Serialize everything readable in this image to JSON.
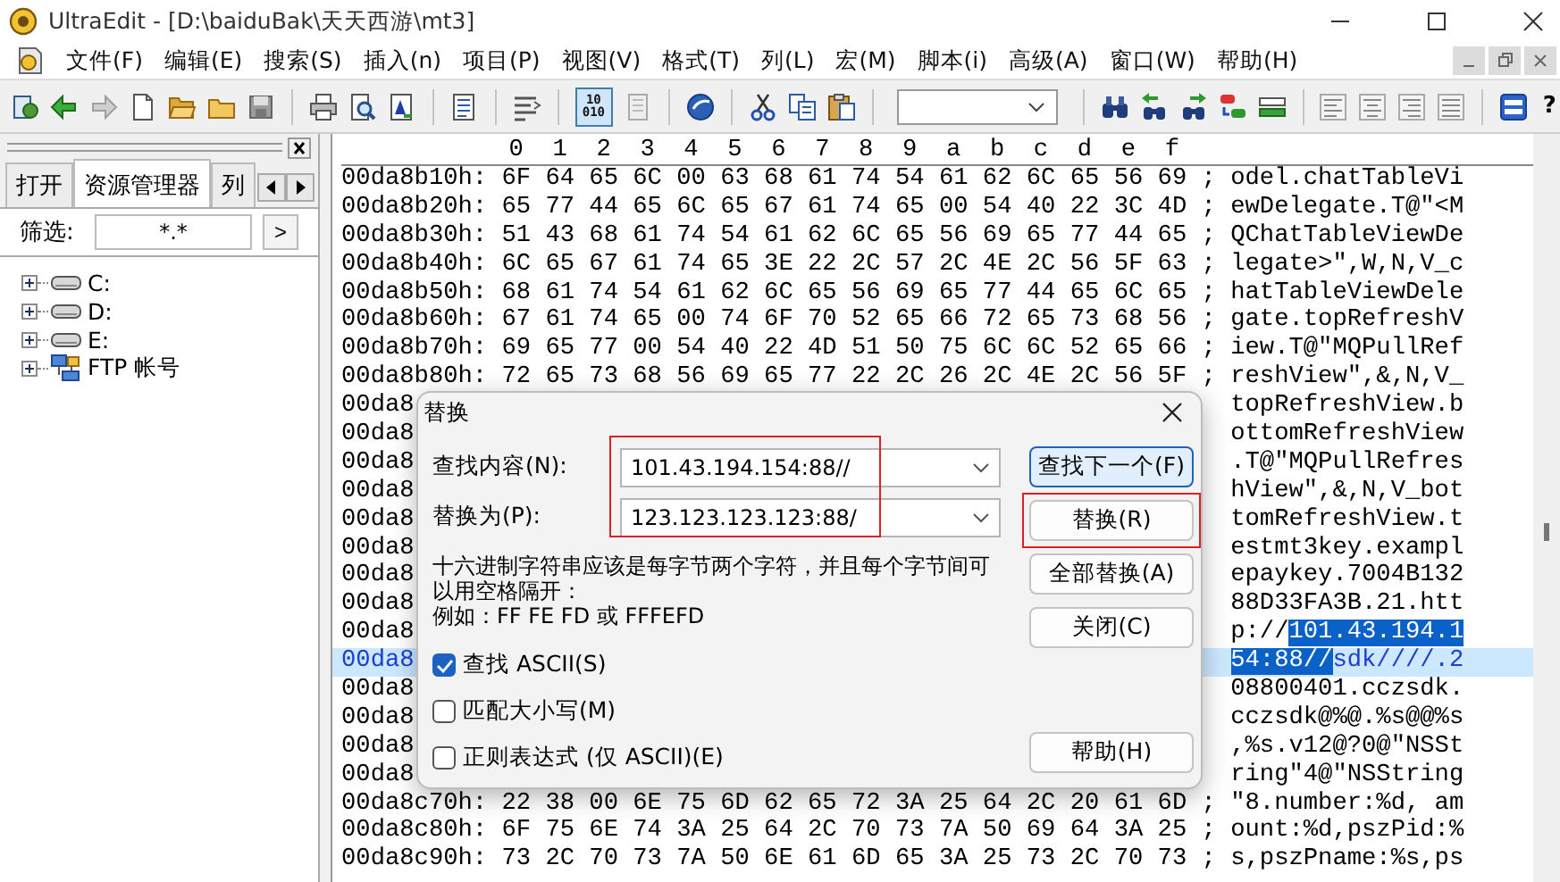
{
  "window": {
    "title": "UltraEdit - [D:\\baiduBak\\天天西游\\mt3]"
  },
  "menu": [
    {
      "label": "文件(F)"
    },
    {
      "label": "编辑(E)"
    },
    {
      "label": "搜索(S)"
    },
    {
      "label": "插入(n)"
    },
    {
      "label": "项目(P)"
    },
    {
      "label": "视图(V)"
    },
    {
      "label": "格式(T)"
    },
    {
      "label": "列(L)"
    },
    {
      "label": "宏(M)"
    },
    {
      "label": "脚本(i)"
    },
    {
      "label": "高级(A)"
    },
    {
      "label": "窗口(W)"
    },
    {
      "label": "帮助(H)"
    }
  ],
  "toolbar": {
    "hex_mode": {
      "lines": [
        "10",
        "010"
      ],
      "selected": true
    },
    "help_label": "?"
  },
  "side_panel": {
    "tabs": [
      {
        "label": "打开",
        "selected": false
      },
      {
        "label": "资源管理器",
        "selected": true
      },
      {
        "label": "列",
        "selected": false
      }
    ],
    "filter": {
      "label": "筛选:",
      "value": "*.*",
      "button": ">"
    },
    "tree": [
      {
        "label": "C:",
        "kind": "drive",
        "expanded": false
      },
      {
        "label": "D:",
        "kind": "drive",
        "expanded": false
      },
      {
        "label": "E:",
        "kind": "drive",
        "expanded": false
      },
      {
        "label": "FTP 帐号",
        "kind": "network",
        "expanded": false
      }
    ]
  },
  "hex_view": {
    "ruler": [
      "0",
      "1",
      "2",
      "3",
      "4",
      "5",
      "6",
      "7",
      "8",
      "9",
      "a",
      "b",
      "c",
      "d",
      "e",
      "f"
    ],
    "rows": [
      {
        "offset": "00da8b10h:",
        "bytes": "6F 64 65 6C 00 63 68 61 74 54 61 62 6C 65 56 69",
        "sep": ";",
        "ascii": [
          {
            "text": "odel.chatTableVi",
            "selected": false
          }
        ],
        "current": false
      },
      {
        "offset": "00da8b20h:",
        "bytes": "65 77 44 65 6C 65 67 61 74 65 00 54 40 22 3C 4D",
        "sep": ";",
        "ascii": [
          {
            "text": "ewDelegate.T@\"<M",
            "selected": false
          }
        ],
        "current": false
      },
      {
        "offset": "00da8b30h:",
        "bytes": "51 43 68 61 74 54 61 62 6C 65 56 69 65 77 44 65",
        "sep": ";",
        "ascii": [
          {
            "text": "QChatTableViewDe",
            "selected": false
          }
        ],
        "current": false
      },
      {
        "offset": "00da8b40h:",
        "bytes": "6C 65 67 61 74 65 3E 22 2C 57 2C 4E 2C 56 5F 63",
        "sep": ";",
        "ascii": [
          {
            "text": "legate>\",W,N,V_c",
            "selected": false
          }
        ],
        "current": false
      },
      {
        "offset": "00da8b50h:",
        "bytes": "68 61 74 54 61 62 6C 65 56 69 65 77 44 65 6C 65",
        "sep": ";",
        "ascii": [
          {
            "text": "hatTableViewDele",
            "selected": false
          }
        ],
        "current": false
      },
      {
        "offset": "00da8b60h:",
        "bytes": "67 61 74 65 00 74 6F 70 52 65 66 72 65 73 68 56",
        "sep": ";",
        "ascii": [
          {
            "text": "gate.topRefreshV",
            "selected": false
          }
        ],
        "current": false
      },
      {
        "offset": "00da8b70h:",
        "bytes": "69 65 77 00 54 40 22 4D 51 50 75 6C 6C 52 65 66",
        "sep": ";",
        "ascii": [
          {
            "text": "iew.T@\"MQPullRef",
            "selected": false
          }
        ],
        "current": false
      },
      {
        "offset": "00da8b80h:",
        "bytes": "72 65 73 68 56 69 65 77 22 2C 26 2C 4E 2C 56 5F",
        "sep": ";",
        "ascii": [
          {
            "text": "reshView\",&,N,V_",
            "selected": false
          }
        ],
        "current": false
      },
      {
        "offset": "00da8",
        "ascii": [
          {
            "text": "topRefreshView.b",
            "selected": false
          }
        ],
        "current": false
      },
      {
        "offset": "00da8",
        "ascii": [
          {
            "text": "ottomRefreshView",
            "selected": false
          }
        ],
        "current": false
      },
      {
        "offset": "00da8",
        "ascii": [
          {
            "text": ".T@\"MQPullRefres",
            "selected": false
          }
        ],
        "current": false
      },
      {
        "offset": "00da8",
        "ascii": [
          {
            "text": "hView\",&,N,V_bot",
            "selected": false
          }
        ],
        "current": false
      },
      {
        "offset": "00da8",
        "ascii": [
          {
            "text": "tomRefreshView.t",
            "selected": false
          }
        ],
        "current": false
      },
      {
        "offset": "00da8",
        "ascii": [
          {
            "text": "estmt3key.exampl",
            "selected": false
          }
        ],
        "current": false
      },
      {
        "offset": "00da8",
        "ascii": [
          {
            "text": "epaykey.7004B132",
            "selected": false
          }
        ],
        "current": false
      },
      {
        "offset": "00da8",
        "ascii": [
          {
            "text": "88D33FA3B.21.htt",
            "selected": false
          }
        ],
        "current": false
      },
      {
        "offset": "00da8",
        "ascii": [
          {
            "text": "p://",
            "selected": false
          },
          {
            "text": "101.43.194.1",
            "selected": true
          }
        ],
        "current": false
      },
      {
        "offset": "00da8",
        "ascii": [
          {
            "text": "54:88//",
            "selected": true
          },
          {
            "text": "sdk////.2",
            "selected": false
          }
        ],
        "current": true
      },
      {
        "offset": "00da8",
        "ascii": [
          {
            "text": "08800401.cczsdk.",
            "selected": false
          }
        ],
        "current": false
      },
      {
        "offset": "00da8",
        "ascii": [
          {
            "text": "cczsdk@%@.%s@@%s",
            "selected": false
          }
        ],
        "current": false
      },
      {
        "offset": "00da8",
        "ascii": [
          {
            "text": ",%s.v12@?0@\"NSSt",
            "selected": false
          }
        ],
        "current": false
      },
      {
        "offset": "00da8",
        "ascii": [
          {
            "text": "ring\"4@\"NSString",
            "selected": false
          }
        ],
        "current": false
      },
      {
        "offset": "00da8c70h:",
        "bytes": "22 38 00 6E 75 6D 62 65 72 3A 25 64 2C 20 61 6D",
        "sep": ";",
        "ascii": [
          {
            "text": "\"8.number:%d, am",
            "selected": false
          }
        ],
        "current": false
      },
      {
        "offset": "00da8c80h:",
        "bytes": "6F 75 6E 74 3A 25 64 2C 70 73 7A 50 69 64 3A 25",
        "sep": ";",
        "ascii": [
          {
            "text": "ount:%d,pszPid:%",
            "selected": false
          }
        ],
        "current": false
      },
      {
        "offset": "00da8c90h:",
        "bytes": "73 2C 70 73 7A 50 6E 61 6D 65 3A 25 73 2C 70 73",
        "sep": ";",
        "ascii": [
          {
            "text": "s,pszPname:%s,ps",
            "selected": false
          }
        ],
        "current": false
      }
    ]
  },
  "dialog": {
    "title": "替换",
    "fields": [
      {
        "label": "查找内容(N):",
        "value": "101.43.194.154:88//"
      },
      {
        "label": "替换为(P):",
        "value": "123.123.123.123:88/"
      }
    ],
    "fields_marked": true,
    "hint": "十六进制字符串应该是每字节两个字符，并且每个字节间可以用空格隔开：",
    "example": "例如：FF FE FD 或 FFFEFD",
    "options": [
      {
        "label": "查找 ASCII(S)",
        "checked": true
      },
      {
        "label": "匹配大小写(M)",
        "checked": false
      },
      {
        "label": "正则表达式 (仅 ASCII)(E)",
        "checked": false
      }
    ],
    "buttons": [
      {
        "label": "查找下一个(F)",
        "default": true,
        "marked": false
      },
      {
        "label": "替换(R)",
        "default": false,
        "marked": true
      },
      {
        "label": "全部替换(A)",
        "default": false,
        "marked": false
      },
      {
        "label": "关闭(C)",
        "default": false,
        "marked": false
      },
      {
        "label": "帮助(H)",
        "default": false,
        "marked": false
      }
    ]
  }
}
